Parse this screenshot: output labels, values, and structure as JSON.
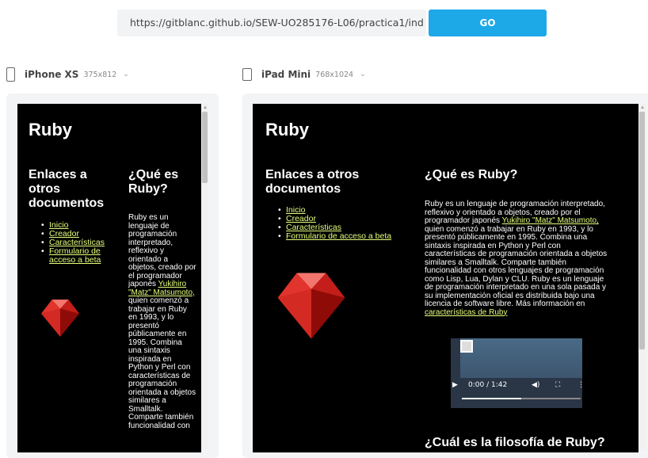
{
  "toolbar": {
    "url": "https://gitblanc.github.io/SEW-UO285176-L06/practica1/ind",
    "go_label": "GO"
  },
  "devices": [
    {
      "name": "iPhone XS",
      "size": "375x812",
      "page": {
        "title": "Ruby",
        "links_heading": "Enlaces a otros documentos",
        "links": [
          "Inicio",
          "Creador",
          "Características",
          "Formulario de acceso a beta"
        ],
        "section_heading": "¿Qué es Ruby?",
        "p_lines": [
          "Ruby es un",
          "lenguaje de",
          "programación",
          "interpretado,",
          "reflexivo y",
          "orientado a",
          "objetos, creado por",
          "el programador",
          "japonés"
        ],
        "author_link_a": "Yukihiro",
        "author_link_b": "\"Matz\" Matsumoto,",
        "p_lines_after": [
          "quien comenzó a",
          "trabajar en Ruby",
          "en 1993, y lo",
          "presentó",
          "públicamente en",
          "1995. Combina",
          "una sintaxis",
          "inspirada en",
          "Python y Perl con",
          "características de",
          "programación",
          "orientada a objetos",
          "similares a",
          "Smalltalk.",
          "Comparte también",
          "funcionalidad con"
        ]
      }
    },
    {
      "name": "iPad Mini",
      "size": "768x1024",
      "page": {
        "title": "Ruby",
        "links_heading": "Enlaces a otros documentos",
        "links": [
          "Inicio",
          "Creador",
          "Características",
          "Formulario de acceso a beta"
        ],
        "section_heading": "¿Qué es Ruby?",
        "p_line1": "Ruby es un lenguaje de programación interpretado,",
        "p_line2": "reflexivo y orientado a objetos, creado por el",
        "p_line3": "programador japonés",
        "author_link": "Yukihiro \"Matz\" Matsumoto,",
        "p_rest": [
          "quien comenzó a trabajar en Ruby en 1993, y lo",
          "presentó públicamente en 1995. Combina una",
          "sintaxis inspirada en Python y Perl con",
          "características de programación orientada a objetos",
          "similares a Smalltalk. Comparte también",
          "funcionalidad con otros lenguajes de programación",
          "como Lisp, Lua, Dylan y CLU. Ruby es un lenguaje",
          "de programación interpretado en una sola pasada y",
          "su implementación oficial es distribuida bajo una",
          "licencia de software libre. Más información en"
        ],
        "more_link": "características de Ruby",
        "video_time": "0:00 / 1:42",
        "next_heading": "¿Cuál es la filosofía de Ruby?"
      }
    }
  ],
  "colors": {
    "accent": "#1da8e8",
    "link": "#e4ff7a",
    "page_bg": "#000000"
  },
  "video_progress": 0.5
}
